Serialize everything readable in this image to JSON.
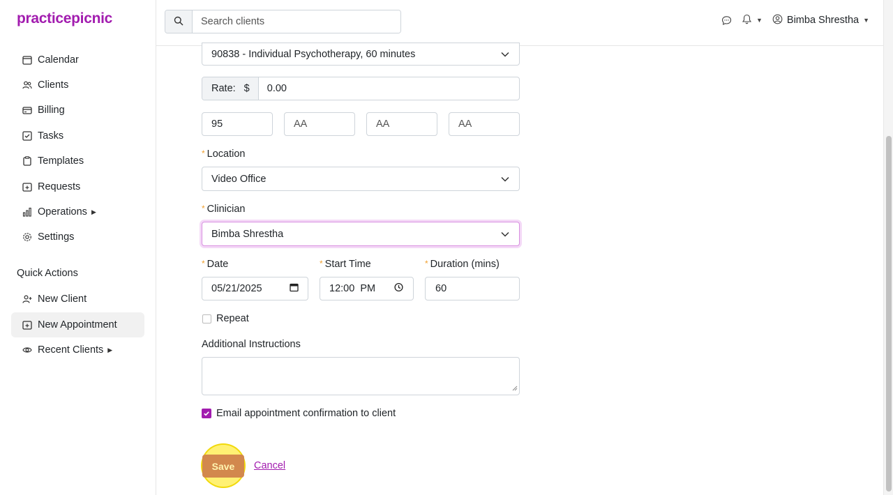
{
  "brand": {
    "logo_text": "practicepicnic"
  },
  "sidebar": {
    "items": [
      {
        "label": "Calendar"
      },
      {
        "label": "Clients"
      },
      {
        "label": "Billing"
      },
      {
        "label": "Tasks"
      },
      {
        "label": "Templates"
      },
      {
        "label": "Requests"
      },
      {
        "label": "Operations"
      },
      {
        "label": "Settings"
      }
    ],
    "quick_actions_title": "Quick Actions",
    "quick_actions": [
      {
        "label": "New Client"
      },
      {
        "label": "New Appointment"
      },
      {
        "label": "Recent Clients"
      }
    ]
  },
  "header": {
    "search_placeholder": "Search clients",
    "user_name": "Bimba Shrestha"
  },
  "form": {
    "service_code": "90838 - Individual Psychotherapy, 60 minutes",
    "rate_label": "Rate:",
    "currency_symbol": "$",
    "rate_value": "0.00",
    "modifiers": [
      {
        "value": "95",
        "placeholder": "AA"
      },
      {
        "value": "",
        "placeholder": "AA"
      },
      {
        "value": "",
        "placeholder": "AA"
      },
      {
        "value": "",
        "placeholder": "AA"
      }
    ],
    "location_label": "Location",
    "location_value": "Video Office",
    "clinician_label": "Clinician",
    "clinician_value": "Bimba Shrestha",
    "date_label": "Date",
    "date_value": "05/21/2025",
    "start_time_label": "Start Time",
    "start_time_value": "12:00  PM",
    "duration_label": "Duration (mins)",
    "duration_value": "60",
    "repeat_label": "Repeat",
    "repeat_checked": false,
    "instructions_label": "Additional Instructions",
    "instructions_value": "",
    "email_confirm_label": "Email appointment confirmation to client",
    "email_confirm_checked": true,
    "save_label": "Save",
    "cancel_label": "Cancel"
  },
  "colors": {
    "brand": "#a21caf",
    "required_marker": "#f0a030",
    "save_button": "#d2884d"
  }
}
